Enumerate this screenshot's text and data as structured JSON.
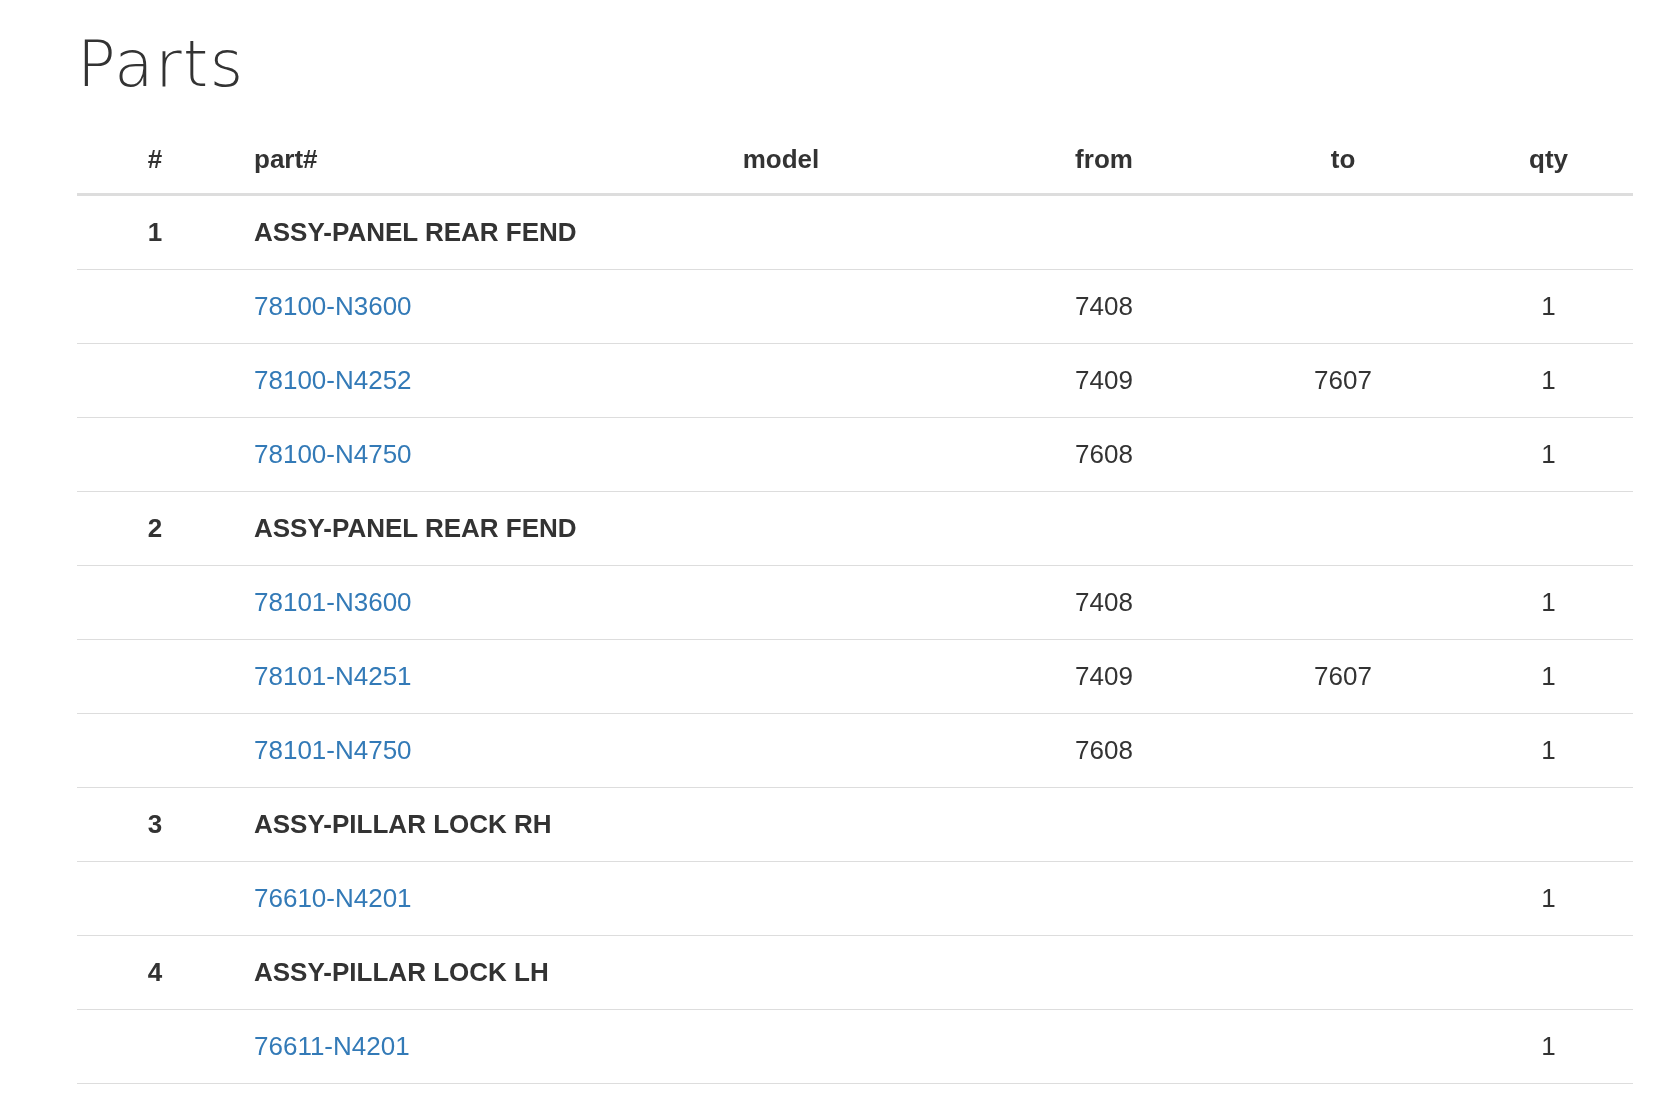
{
  "title": "Parts",
  "columns": [
    "#",
    "part#",
    "model",
    "from",
    "to",
    "qty"
  ],
  "groups": [
    {
      "number": "1",
      "name": "ASSY-PANEL REAR FEND",
      "parts": [
        {
          "part": "78100-N3600",
          "from": "7408",
          "qty": "1"
        },
        {
          "part": "78100-N4252",
          "from": "7409",
          "to": "7607",
          "qty": "1"
        },
        {
          "part": "78100-N4750",
          "from": "7608",
          "qty": "1"
        }
      ]
    },
    {
      "number": "2",
      "name": "ASSY-PANEL REAR FEND",
      "parts": [
        {
          "part": "78101-N3600",
          "from": "7408",
          "qty": "1"
        },
        {
          "part": "78101-N4251",
          "from": "7409",
          "to": "7607",
          "qty": "1"
        },
        {
          "part": "78101-N4750",
          "from": "7608",
          "qty": "1"
        }
      ]
    },
    {
      "number": "3",
      "name": "ASSY-PILLAR LOCK RH",
      "parts": [
        {
          "part": "76610-N4201",
          "qty": "1"
        }
      ]
    },
    {
      "number": "4",
      "name": "ASSY-PILLAR LOCK LH",
      "parts": [
        {
          "part": "76611-N4201",
          "qty": "1"
        }
      ]
    }
  ]
}
